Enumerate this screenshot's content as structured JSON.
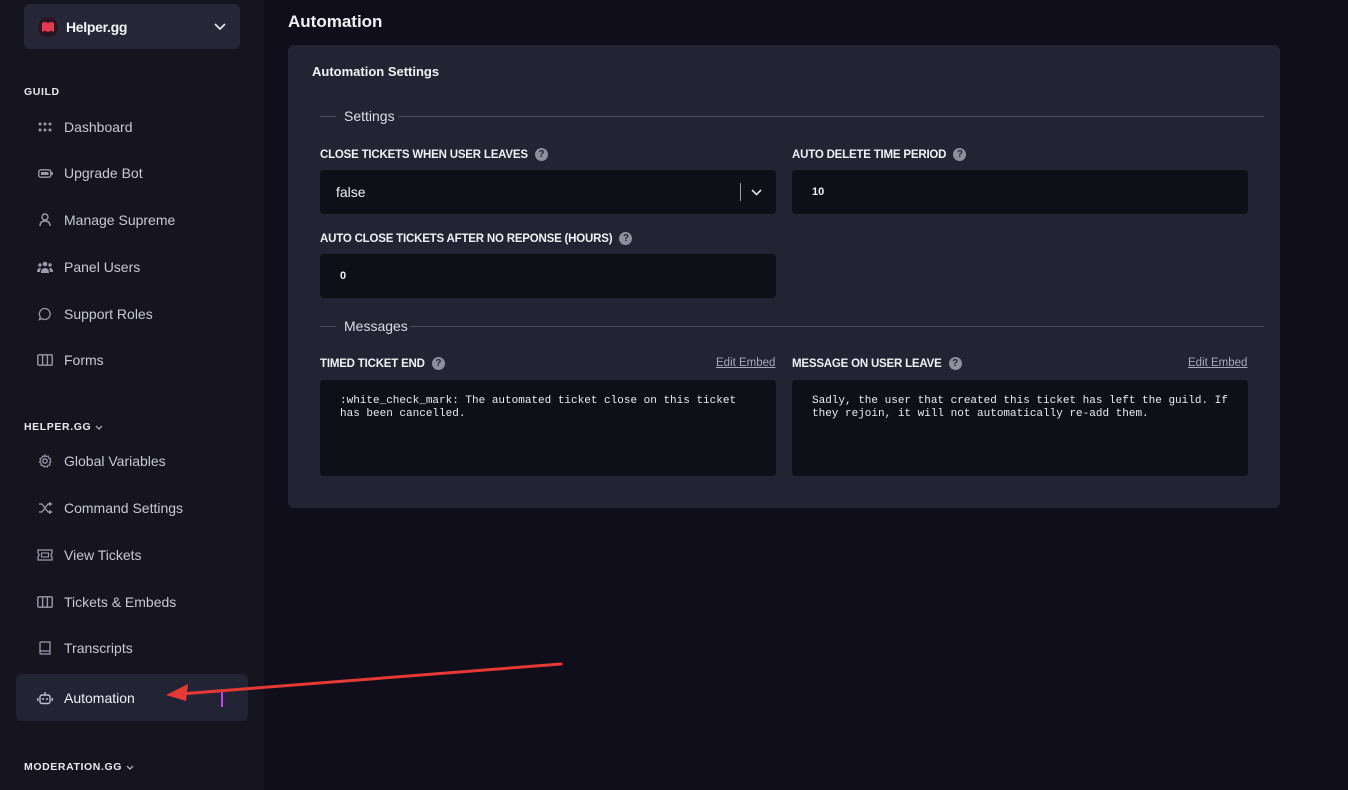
{
  "sidebar": {
    "guild_name": "Helper.gg",
    "sections": {
      "guild": "GUILD",
      "helper": "HELPER.GG",
      "moderation": "MODERATION.GG"
    },
    "items": [
      {
        "label": "Dashboard",
        "icon": "grid-dots-icon"
      },
      {
        "label": "Upgrade Bot",
        "icon": "battery-icon"
      },
      {
        "label": "Manage Supreme",
        "icon": "user-icon"
      },
      {
        "label": "Panel Users",
        "icon": "users-icon"
      },
      {
        "label": "Support Roles",
        "icon": "chat-bubble-icon"
      },
      {
        "label": "Forms",
        "icon": "columns-icon"
      },
      {
        "label": "Global Variables",
        "icon": "gear-icon"
      },
      {
        "label": "Command Settings",
        "icon": "shuffle-icon"
      },
      {
        "label": "View Tickets",
        "icon": "ticket-icon"
      },
      {
        "label": "Tickets & Embeds",
        "icon": "columns-icon"
      },
      {
        "label": "Transcripts",
        "icon": "book-icon"
      },
      {
        "label": "Automation",
        "icon": "robot-icon",
        "active": true
      }
    ]
  },
  "main": {
    "title": "Automation",
    "card_title": "Automation Settings",
    "settings_legend": "Settings",
    "messages_legend": "Messages",
    "fields": {
      "close_on_leave": {
        "label": "CLOSE TICKETS WHEN USER LEAVES",
        "value": "false"
      },
      "auto_delete": {
        "label": "AUTO DELETE TIME PERIOD",
        "value": "10"
      },
      "auto_close": {
        "label": "AUTO CLOSE TICKETS AFTER NO REPONSE (HOURS)",
        "value": "0"
      },
      "timed_end": {
        "label": "TIMED TICKET END",
        "link": "Edit Embed",
        "value": ":white_check_mark: The automated ticket close on this ticket has been cancelled."
      },
      "user_leave": {
        "label": "MESSAGE ON USER LEAVE",
        "link": "Edit Embed",
        "value": "Sadly, the user that created this ticket has left the guild. If they rejoin, it will not automatically re-add them."
      }
    },
    "help_glyph": "?"
  },
  "colors": {
    "background": "#0f0e1a",
    "sidebar": "#15141f",
    "card": "#232333",
    "input": "#0f0f17",
    "accent": "#b84be0",
    "annotation_arrow": "#e53935"
  }
}
